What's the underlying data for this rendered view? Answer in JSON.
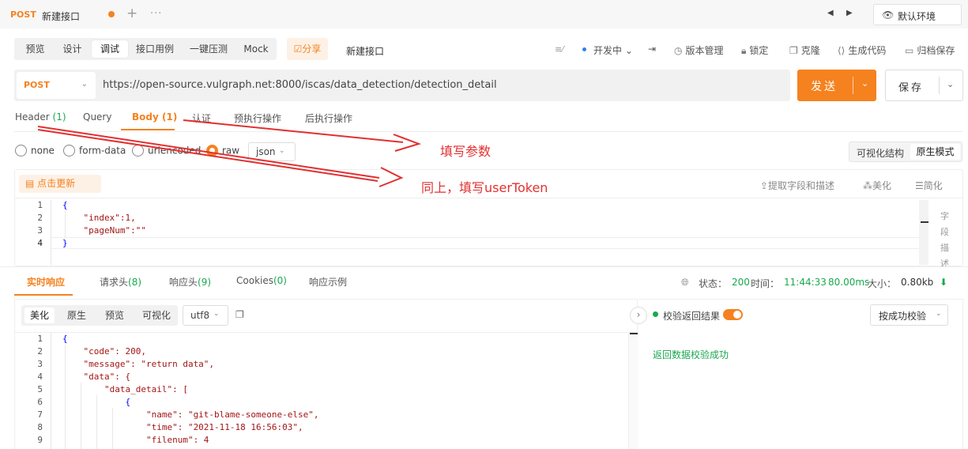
{
  "tab": {
    "method": "POST",
    "title": "新建接口",
    "add_icon": "+",
    "more_icon": "···"
  },
  "env": {
    "label": "默认环境",
    "icon": "eye-icon"
  },
  "modes": [
    "预览",
    "设计",
    "调试",
    "接口用例",
    "一键压测",
    "Mock"
  ],
  "active_mode": "调试",
  "share_label": "☑分享",
  "api_name": "新建接口",
  "status_label": "开发中",
  "tools": {
    "version": "版本管理",
    "lock": "锁定",
    "clone": "克隆",
    "codegen": "生成代码",
    "archive": "归档保存"
  },
  "request": {
    "method": "POST",
    "url": "https://open-source.vulgraph.net:8000/iscas/data_detection/detection_detail"
  },
  "send_label": "发送",
  "save_label": "保存",
  "req_tabs": [
    {
      "label": "Header",
      "count": "(1)"
    },
    {
      "label": "Query",
      "count": ""
    },
    {
      "label": "Body",
      "count": "(1)"
    },
    {
      "label": "认证",
      "count": ""
    },
    {
      "label": "预执行操作",
      "count": ""
    },
    {
      "label": "后执行操作",
      "count": ""
    }
  ],
  "body_types": [
    "none",
    "form-data",
    "urlencoded",
    "raw"
  ],
  "selected_body_type": "raw",
  "raw_format": "json",
  "view_modes": [
    "可视化结构",
    "原生模式"
  ],
  "editor": {
    "update_label": "点击更新",
    "tools": [
      "⇪提取字段和描述",
      "美化",
      "简化"
    ],
    "line_numbers": [
      "1",
      "2",
      "3",
      "4"
    ],
    "lines": [
      "{",
      "    \"index\":1,",
      "    \"pageNum\":\"\"",
      "}"
    ],
    "side_label": [
      "字",
      "段",
      "描",
      "述"
    ]
  },
  "resp_tabs": [
    {
      "label": "实时响应",
      "count": ""
    },
    {
      "label": "请求头",
      "count": "(8)"
    },
    {
      "label": "响应头",
      "count": "(9)"
    },
    {
      "label": "Cookies",
      "count": "(0)"
    },
    {
      "label": "响应示例",
      "count": ""
    }
  ],
  "resp_status": {
    "status_label": "状态：",
    "status": "200",
    "time_label": "时间：",
    "time": "11:44:33",
    "duration": "80.00ms",
    "size_label": "大小：",
    "size": "0.80kb"
  },
  "resp_formats": [
    "美化",
    "原生",
    "预览",
    "可视化"
  ],
  "encoding": "utf8",
  "validate": {
    "label": "校验返回结果",
    "mode": "按成功校验",
    "result": "返回数据校验成功"
  },
  "response": {
    "line_numbers": [
      "1",
      "2",
      "3",
      "4",
      "5",
      "6",
      "7",
      "8",
      "9"
    ],
    "lines": [
      "{",
      "    \"code\": 200,",
      "    \"message\": \"return data\",",
      "    \"data\": {",
      "        \"data_detail\": [",
      "            {",
      "                \"name\": \"git-blame-someone-else\",",
      "                \"time\": \"2021-11-18 16:56:03\",",
      "                \"filenum\": 4"
    ]
  },
  "annotations": {
    "fill_params": "填写参数",
    "same_token": "同上，填写userToken"
  },
  "colors": {
    "accent": "#f5821f",
    "green": "#1aa84f",
    "annotation": "#e23030"
  }
}
